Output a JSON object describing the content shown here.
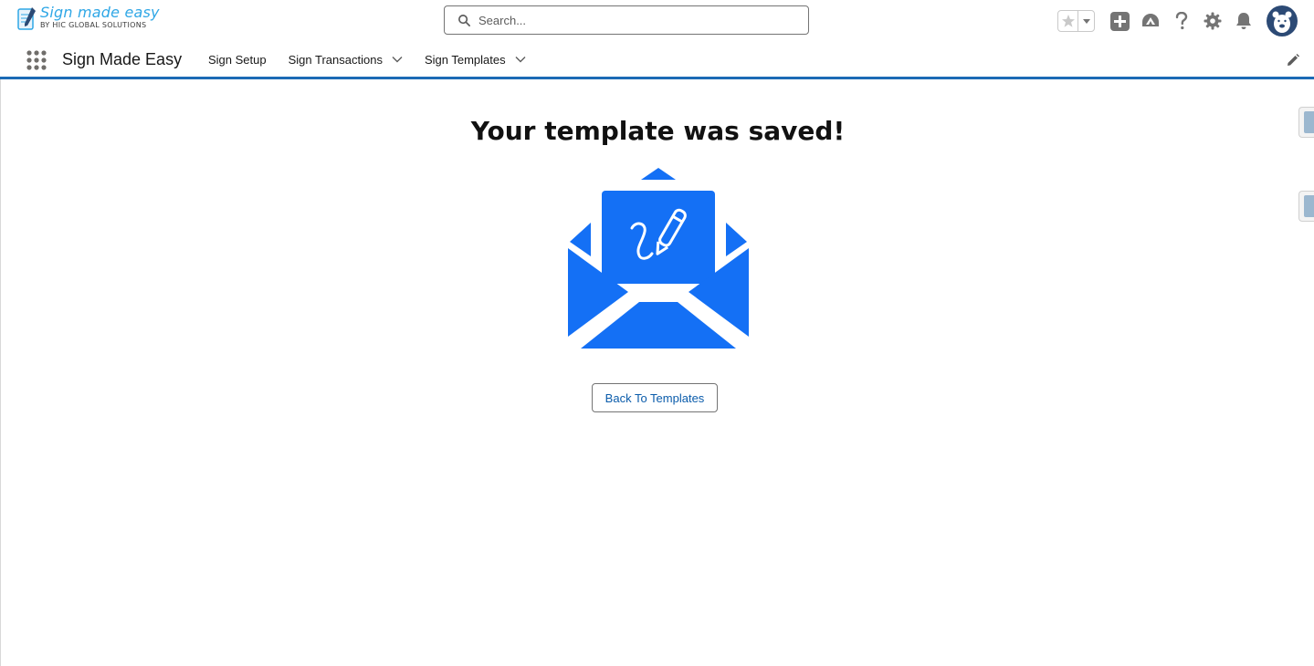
{
  "brand": {
    "logo_title": "Sign made easy",
    "logo_subtitle": "BY HIC GLOBAL SOLUTIONS",
    "accent_color": "#1b6ab5",
    "logo_color": "#2fa7e6"
  },
  "search": {
    "placeholder": "Search..."
  },
  "header_icons": [
    "star-icon",
    "chevron-down-icon",
    "plus-icon",
    "trailhead-icon",
    "help-icon",
    "gear-icon",
    "bell-icon",
    "avatar"
  ],
  "nav": {
    "app_name": "Sign Made Easy",
    "items": [
      {
        "label": "Sign Setup",
        "has_dropdown": false
      },
      {
        "label": "Sign Transactions",
        "has_dropdown": true
      },
      {
        "label": "Sign Templates",
        "has_dropdown": true
      }
    ]
  },
  "main": {
    "title": "Your template was saved!",
    "illustration": "envelope-signature-icon",
    "illustration_color": "#1470f5",
    "back_button_label": "Back To Templates"
  }
}
